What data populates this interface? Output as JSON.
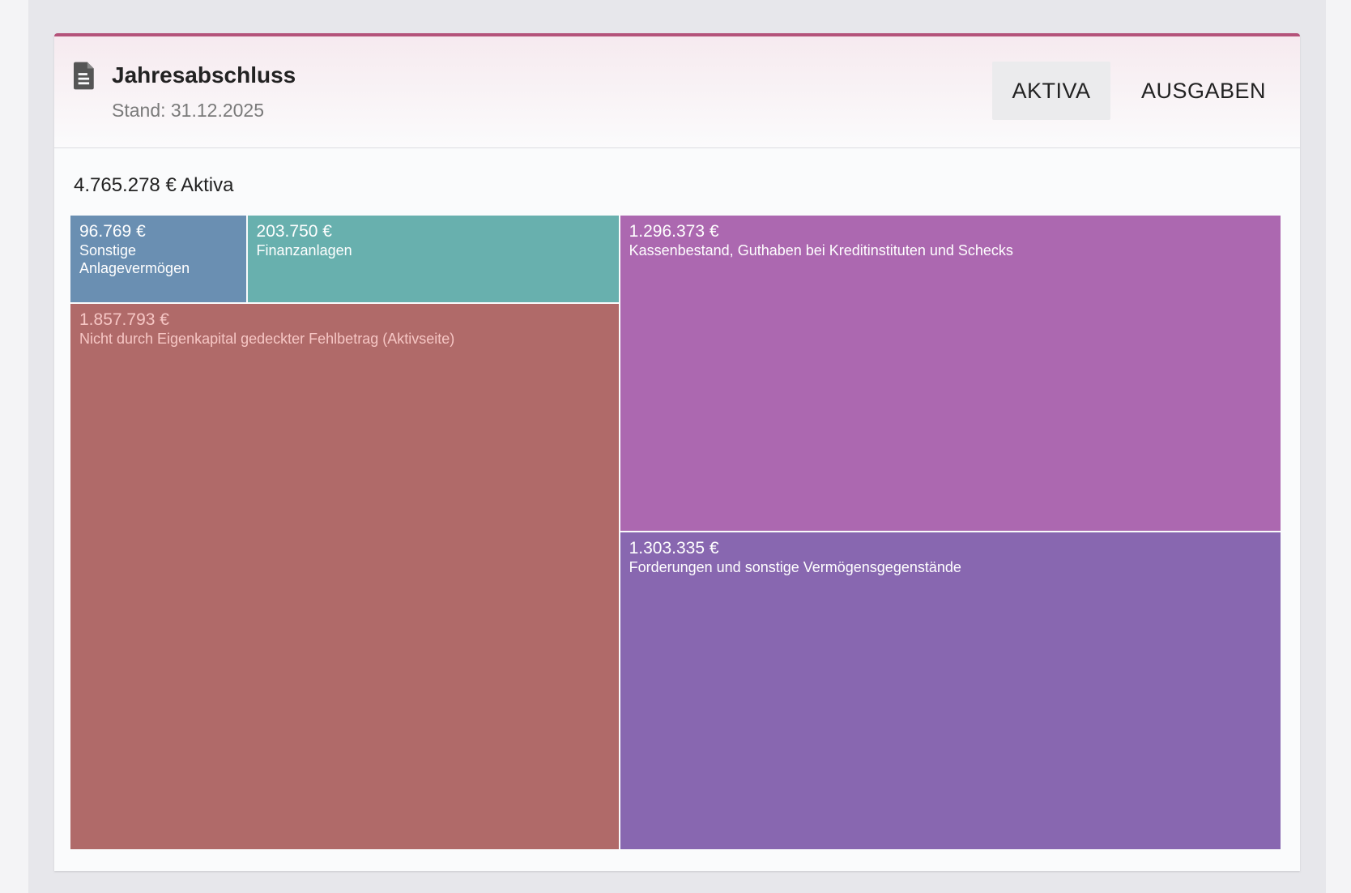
{
  "header": {
    "title": "Jahresabschluss",
    "subtitle": "Stand: 31.12.2025",
    "icon": "document-icon"
  },
  "tabs": [
    {
      "label": "AKTIVA",
      "active": true
    },
    {
      "label": "AUSGABEN",
      "active": false
    }
  ],
  "summary": "4.765.278 € Aktiva",
  "chart_data": {
    "type": "treemap",
    "total": 4765278,
    "items": [
      {
        "value": 96769,
        "value_label": "96.769 €",
        "label": "Sonstige Anlagevermögen",
        "color": "#6a8fb2",
        "text_color": "#ffffff"
      },
      {
        "value": 203750,
        "value_label": "203.750 €",
        "label": "Finanzanlagen",
        "color": "#68b0ae",
        "text_color": "#ffffff"
      },
      {
        "value": 1857793,
        "value_label": "1.857.793 €",
        "label": "Nicht durch Eigenkapital gedeckter Fehlbetrag (Aktivseite)",
        "color": "#b06a69",
        "text_color": "#f6c6c4"
      },
      {
        "value": 1296373,
        "value_label": "1.296.373 €",
        "label": "Kassenbestand, Guthaben bei Kreditinstituten und Schecks",
        "color": "#ac68b0",
        "text_color": "#ffffff"
      },
      {
        "value": 1303335,
        "value_label": "1.303.335 €",
        "label": "Forderungen und sonstige Vermögensgegenstände",
        "color": "#8867b0",
        "text_color": "#ffffff"
      }
    ]
  }
}
